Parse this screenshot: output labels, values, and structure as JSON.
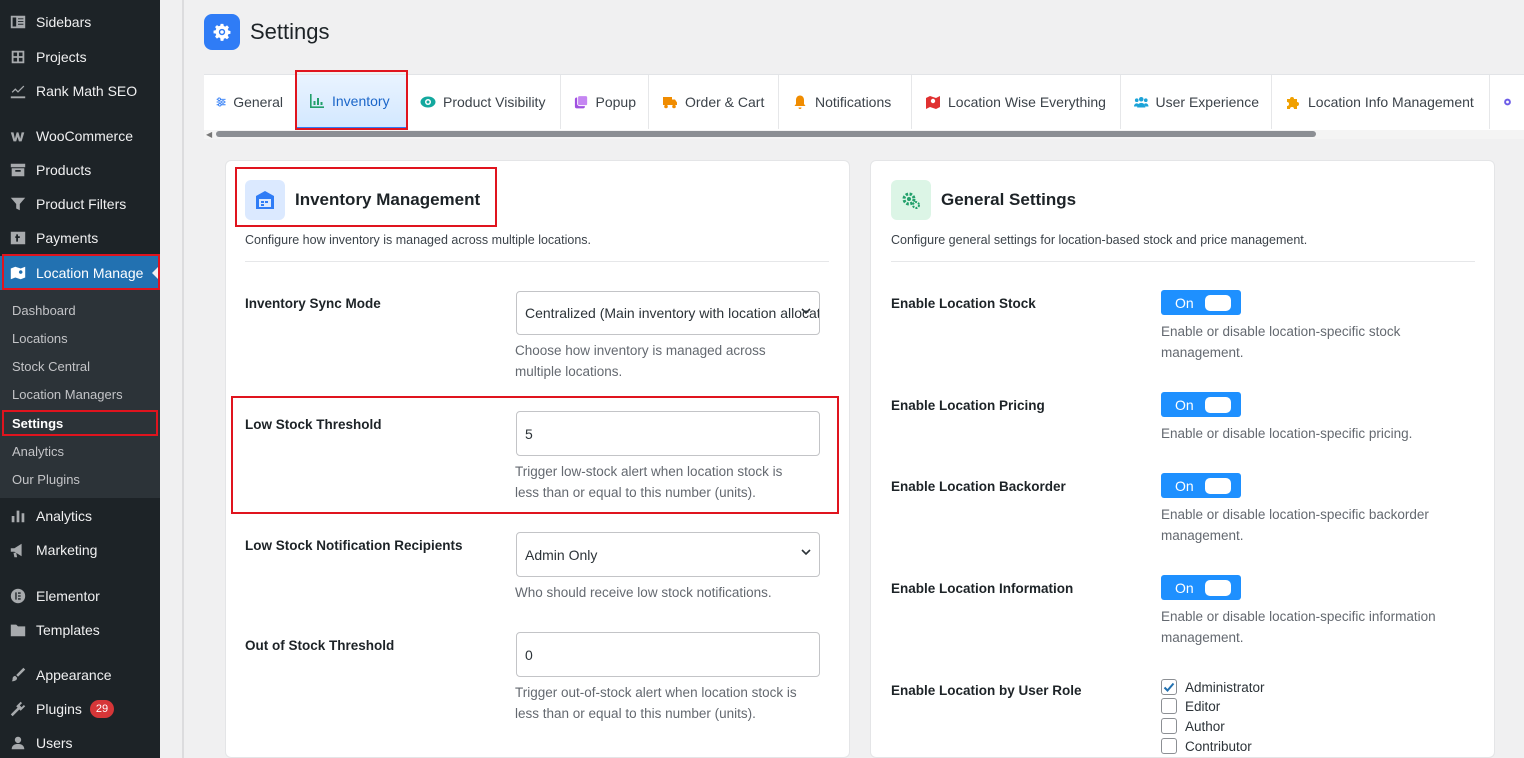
{
  "sidebar": {
    "top_items": [
      {
        "label": "Sidebars",
        "icon": "sidebar-layout-icon"
      },
      {
        "label": "Projects",
        "icon": "projects-icon"
      },
      {
        "label": "Rank Math SEO",
        "icon": "chart-icon"
      },
      {
        "label": "WooCommerce",
        "icon": "woocommerce-icon"
      },
      {
        "label": "Products",
        "icon": "archive-box-icon"
      },
      {
        "label": "Product Filters",
        "icon": "filter-icon"
      },
      {
        "label": "Payments",
        "icon": "payments-icon"
      },
      {
        "label": "Location Manage",
        "icon": "map-icon"
      }
    ],
    "submenu": [
      "Dashboard",
      "Locations",
      "Stock Central",
      "Location Managers",
      "Settings",
      "Analytics",
      "Our Plugins"
    ],
    "bottom_items": [
      {
        "label": "Analytics",
        "icon": "bar-chart-icon"
      },
      {
        "label": "Marketing",
        "icon": "megaphone-icon"
      },
      {
        "label": "Elementor",
        "icon": "elementor-icon"
      },
      {
        "label": "Templates",
        "icon": "folder-icon"
      },
      {
        "label": "Appearance",
        "icon": "paintbrush-icon"
      },
      {
        "label": "Plugins",
        "icon": "plugin-icon",
        "badge": "29"
      },
      {
        "label": "Users",
        "icon": "user-icon"
      }
    ]
  },
  "page": {
    "title": "Settings"
  },
  "tabs": [
    {
      "label": "General",
      "icon": "sliders-icon",
      "color": "#2f7cf6"
    },
    {
      "label": "Inventory",
      "icon": "chart-bars-icon",
      "color": "#22a06b"
    },
    {
      "label": "Product Visibility",
      "icon": "eye-icon",
      "color": "#13a89e"
    },
    {
      "label": "Popup",
      "icon": "popup-icon",
      "color": "#a050e0"
    },
    {
      "label": "Order & Cart",
      "icon": "truck-icon",
      "color": "#f08c00"
    },
    {
      "label": "Notifications",
      "icon": "bell-icon",
      "color": "#f08c00"
    },
    {
      "label": "Location Wise Everything",
      "icon": "map-location-icon",
      "color": "#e03131"
    },
    {
      "label": "User Experience",
      "icon": "users-icon",
      "color": "#1ca3d8"
    },
    {
      "label": "Location Info Management",
      "icon": "puzzle-icon",
      "color": "#f0a000"
    }
  ],
  "inventory": {
    "title": "Inventory Management",
    "description": "Configure how inventory is managed across multiple locations.",
    "sync_mode": {
      "label": "Inventory Sync Mode",
      "value": "Centralized (Main inventory with location allocations)",
      "help_line1": "Choose how inventory is managed across",
      "help_line2": "multiple locations."
    },
    "low_stock": {
      "label": "Low Stock Threshold",
      "value": "5",
      "help_line1": "Trigger low-stock alert when location stock is",
      "help_line2": "less than or equal to this number (units)."
    },
    "recipients": {
      "label": "Low Stock Notification Recipients",
      "value": "Admin Only",
      "help_line1": "Who should receive low stock notifications."
    },
    "out_of_stock": {
      "label": "Out of Stock Threshold",
      "value": "0",
      "help_line1": "Trigger out-of-stock alert when location stock is",
      "help_line2": "less than or equal to this number (units)."
    }
  },
  "general": {
    "title": "General Settings",
    "description": "Configure general settings for location-based stock and price management.",
    "location_stock": {
      "label": "Enable Location Stock",
      "toggle": "On",
      "help_line1": "Enable or disable location-specific stock",
      "help_line2": "management."
    },
    "location_pricing": {
      "label": "Enable Location Pricing",
      "toggle": "On",
      "help_line1": "Enable or disable location-specific pricing."
    },
    "location_backorder": {
      "label": "Enable Location Backorder",
      "toggle": "On",
      "help_line1": "Enable or disable location-specific backorder",
      "help_line2": "management."
    },
    "location_info": {
      "label": "Enable Location Information",
      "toggle": "On",
      "help_line1": "Enable or disable location-specific information",
      "help_line2": "management."
    },
    "user_role": {
      "label": "Enable Location by User Role",
      "roles": [
        {
          "name": "Administrator",
          "checked": true
        },
        {
          "name": "Editor",
          "checked": false
        },
        {
          "name": "Author",
          "checked": false
        },
        {
          "name": "Contributor",
          "checked": false
        }
      ]
    }
  },
  "colors": {
    "accent": "#2f7cf6",
    "toggle": "#1e90ff",
    "admin_menu": "#1d2327",
    "highlight": "#e0141e"
  }
}
